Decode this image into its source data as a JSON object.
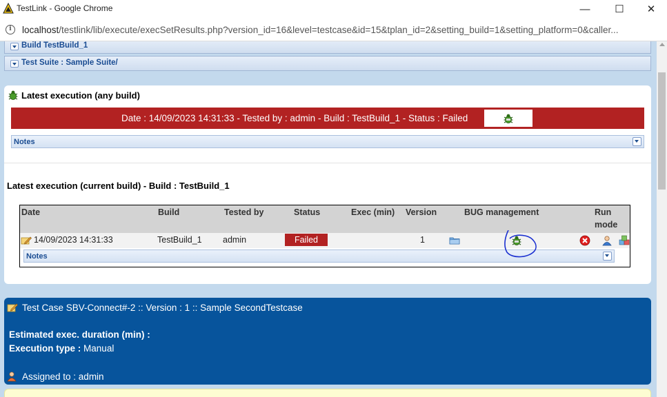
{
  "window": {
    "title": "TestLink - Google Chrome",
    "minimize": "—",
    "maximize": "☐",
    "close": "✕"
  },
  "address_bar": {
    "host": "localhost",
    "path": "/testlink/lib/execute/execSetResults.php?version_id=16&level=testcase&id=15&tplan_id=2&setting_build=1&setting_platform=0&caller..."
  },
  "breadcrumbs": {
    "build_label": "Build TestBuild_1",
    "suite_label": "Test Suite : Sample Suite/"
  },
  "latest_any": {
    "heading": "Latest execution (any build)",
    "status_text": "Date : 14/09/2023 14:31:33 - Tested by : admin - Build : TestBuild_1 - Status : Failed",
    "status_color": "#b22222",
    "notes_label": "Notes"
  },
  "latest_current": {
    "heading": "Latest execution (current build) - Build : TestBuild_1",
    "columns": {
      "date": "Date",
      "build": "Build",
      "tested_by": "Tested by",
      "status": "Status",
      "exec_min": "Exec (min)",
      "version": "Version",
      "bug_management": "BUG management",
      "run_mode_1": "Run",
      "run_mode_2": "mode"
    },
    "row": {
      "date": "14/09/2023 14:31:33",
      "build": "TestBuild_1",
      "tested_by": "admin",
      "status": "Failed",
      "exec_min": "",
      "version": "1"
    },
    "notes_label": "Notes"
  },
  "test_case": {
    "title": "Test Case SBV-Connect#-2 :: Version : 1 :: Sample SecondTestcase",
    "duration_label": "Estimated exec. duration (min) :",
    "exec_type_label": "Execution type :",
    "exec_type_value": "Manual",
    "assigned": "Assigned to : admin",
    "panel_color": "#07549c"
  },
  "icons": [
    "bug-icon",
    "info-icon",
    "folder-icon",
    "delete-icon",
    "user-icon",
    "cubes-icon",
    "pencil-note-icon",
    "chevron-down-icon"
  ]
}
